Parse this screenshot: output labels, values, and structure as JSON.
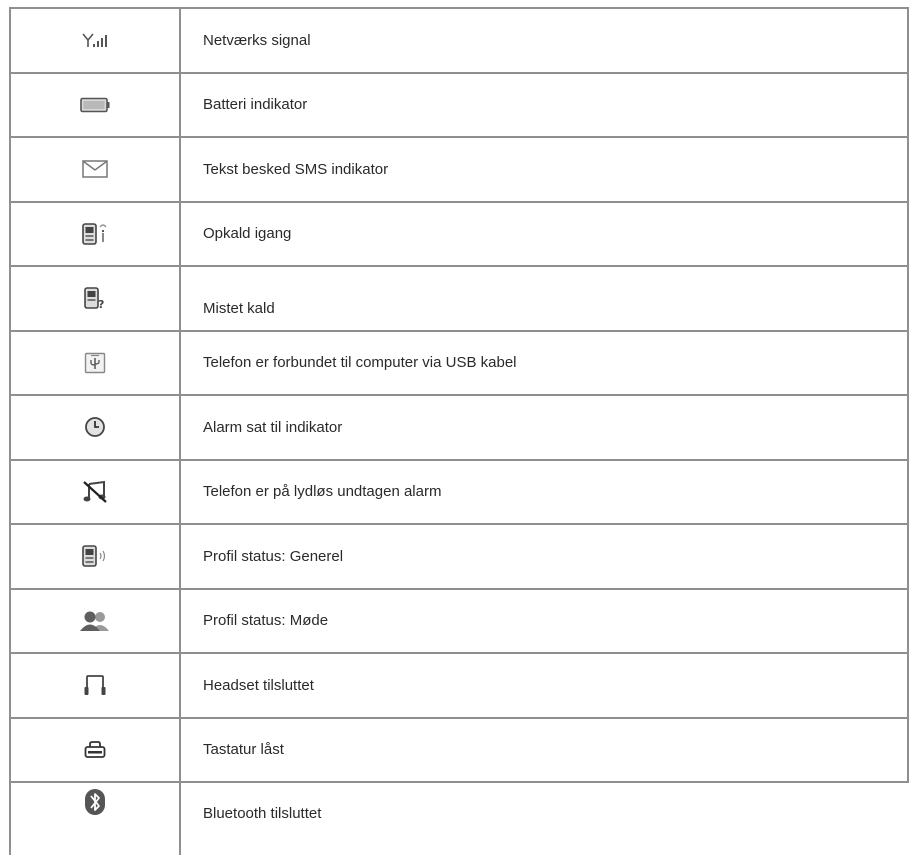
{
  "rows": [
    {
      "icon": "signal-strength-icon",
      "label": "Netværks signal"
    },
    {
      "icon": "battery-icon",
      "label": "Batteri indikator"
    },
    {
      "icon": "envelope-icon",
      "label": "Tekst besked SMS indikator"
    },
    {
      "icon": "phone-call-icon",
      "label": "Opkald igang"
    },
    {
      "icon": "phone-missed-call-icon",
      "label": "Mistet kald"
    },
    {
      "icon": "usb-connected-icon",
      "label": "Telefon er forbundet til computer via USB kabel"
    },
    {
      "icon": "alarm-clock-icon",
      "label": "Alarm sat til indikator"
    },
    {
      "icon": "silent-mode-icon",
      "label": "Telefon er på lydløs undtagen alarm"
    },
    {
      "icon": "profile-general-icon",
      "label": "Profil status: Generel"
    },
    {
      "icon": "profile-meeting-icon",
      "label": "Profil status: Møde"
    },
    {
      "icon": "headset-icon",
      "label": "Headset tilsluttet"
    },
    {
      "icon": "keypad-lock-icon",
      "label": "Tastatur låst"
    },
    {
      "icon": "bluetooth-icon",
      "label": "Bluetooth tilsluttet"
    }
  ]
}
